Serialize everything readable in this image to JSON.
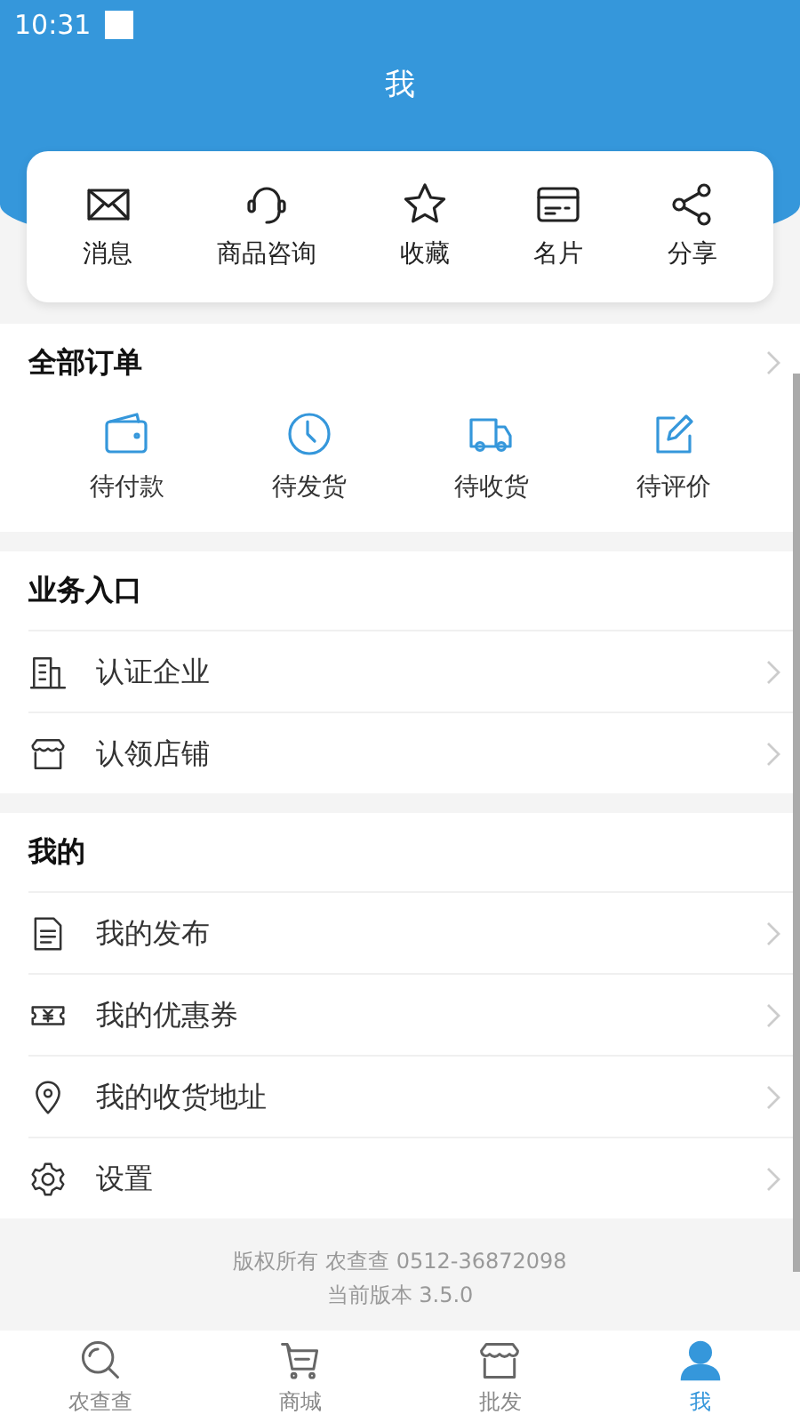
{
  "status_bar": {
    "time": "10:31"
  },
  "header": {
    "title": "我"
  },
  "quick_actions": [
    {
      "kind": "mail",
      "label": "消息"
    },
    {
      "kind": "headset",
      "label": "商品咨询"
    },
    {
      "kind": "star",
      "label": "收藏"
    },
    {
      "kind": "card",
      "label": "名片"
    },
    {
      "kind": "share",
      "label": "分享"
    }
  ],
  "orders": {
    "title": "全部订单",
    "items": [
      {
        "kind": "wallet",
        "label": "待付款"
      },
      {
        "kind": "clock",
        "label": "待发货"
      },
      {
        "kind": "truck",
        "label": "待收货"
      },
      {
        "kind": "edit",
        "label": "待评价"
      }
    ]
  },
  "sections": [
    {
      "title": "业务入口",
      "items": [
        {
          "kind": "building",
          "label": "认证企业"
        },
        {
          "kind": "store",
          "label": "认领店铺"
        }
      ]
    },
    {
      "title": "我的",
      "items": [
        {
          "kind": "document",
          "label": "我的发布"
        },
        {
          "kind": "coupon",
          "label": "我的优惠券"
        },
        {
          "kind": "location",
          "label": "我的收货地址"
        },
        {
          "kind": "gear",
          "label": "设置"
        }
      ]
    }
  ],
  "footer": [
    "版权所有 农查查 0512-36872098",
    "当前版本 3.5.0"
  ],
  "tab_bar": [
    {
      "kind": "search",
      "label": "农查查",
      "selected": false
    },
    {
      "kind": "cart",
      "label": "商城",
      "selected": false
    },
    {
      "kind": "shop",
      "label": "批发",
      "selected": false
    },
    {
      "kind": "person",
      "label": "我",
      "selected": true
    }
  ]
}
